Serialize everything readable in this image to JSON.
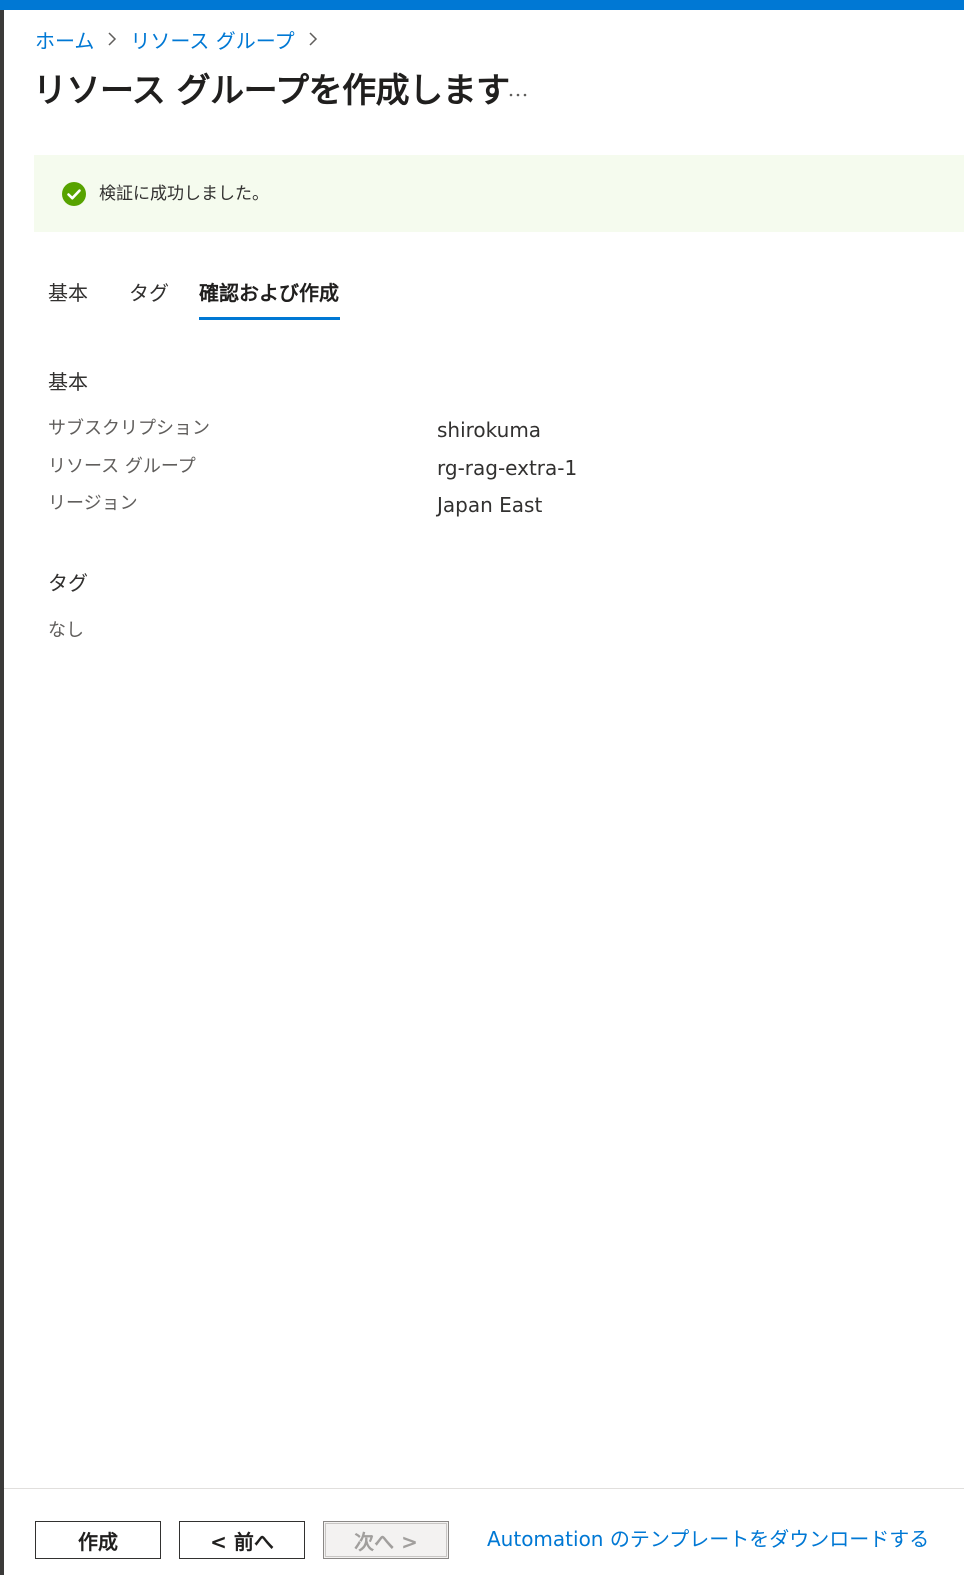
{
  "breadcrumb": {
    "items": [
      "ホーム",
      "リソース グループ"
    ]
  },
  "page": {
    "title": "リソース グループを作成します",
    "more_label": "..."
  },
  "banner": {
    "message": "検証に成功しました。",
    "status_color": "#57a300",
    "background_color": "#f5fbee"
  },
  "tabs": {
    "items": [
      "基本",
      "タグ",
      "確認および作成"
    ],
    "active_index": 2
  },
  "summary": {
    "basics_title": "基本",
    "rows": [
      {
        "label": "サブスクリプション",
        "value": "shirokuma"
      },
      {
        "label": "リソース グループ",
        "value": "rg-rag-extra-1"
      },
      {
        "label": "リージョン",
        "value": "Japan East"
      }
    ],
    "tags_title": "タグ",
    "tags_value": "なし"
  },
  "footer": {
    "create_label": "作成",
    "prev_label": "< 前へ",
    "next_label": "次へ >",
    "next_disabled": true,
    "download_link": "Automation のテンプレートをダウンロードする"
  },
  "colors": {
    "accent": "#0078d4",
    "text": "#323130",
    "muted": "#605e5c"
  },
  "icons": {
    "banner": "success-check-icon",
    "breadcrumb_separator": "chevron-right-icon",
    "more": "more-horizontal-icon"
  }
}
